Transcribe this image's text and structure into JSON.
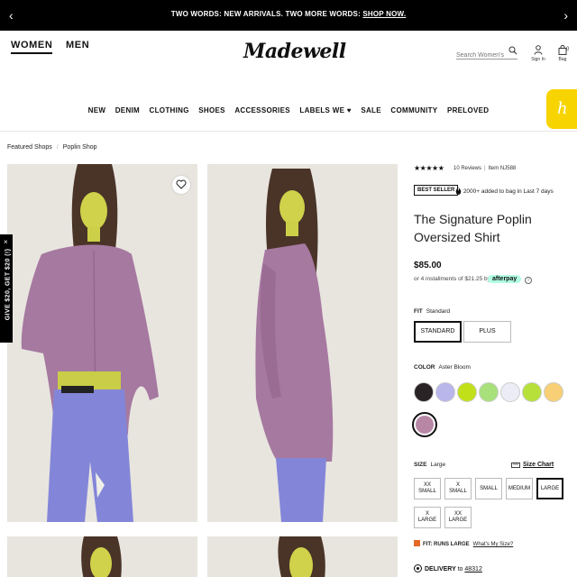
{
  "promo": {
    "message": "TWO WORDS: NEW ARRIVALS. TWO MORE WORDS: ",
    "link": "SHOP NOW.",
    "prev_icon": "chevron-left-icon",
    "next_icon": "chevron-right-icon"
  },
  "header": {
    "women": "WOMEN",
    "men": "MEN",
    "logo": "Madewell",
    "search_placeholder": "Search Women's",
    "signin": "Sign In",
    "bag": "Bag",
    "bag_count": "0"
  },
  "nav": [
    "NEW",
    "DENIM",
    "CLOTHING",
    "SHOES",
    "ACCESSORIES",
    "LABELS WE ♥",
    "SALE",
    "COMMUNITY",
    "PRELOVED"
  ],
  "breadcrumbs": [
    "Featured Shops",
    "Poplin Shop"
  ],
  "side_promo": {
    "text": "GIVE $20, GET $20 (!)",
    "close": "×"
  },
  "product": {
    "stars": "★★★★★",
    "rating": 4.5,
    "reviews": "10 Reviews",
    "item": "Item NJ588",
    "badge": "BEST SELLER",
    "added": "2000+ added to bag in Last 7 days",
    "title": "The Signature Poplin Oversized Shirt",
    "price": "$85.00",
    "installments": "or 4 installments of $21.25 by",
    "afterpay": "afterpay",
    "fit_label": "FIT",
    "fit_value": "Standard",
    "fit_options": [
      "STANDARD",
      "PLUS"
    ],
    "color_label": "COLOR",
    "color_value": "Aster Bloom",
    "colors": [
      "#2a2326",
      "#b9b6ec",
      "#c2e01a",
      "#a8e07c",
      "#ececf6",
      "#b8e03a",
      "#f8cf74",
      "#b887a6"
    ],
    "size_label": "SIZE",
    "size_value": "Large",
    "size_chart": "Size Chart",
    "sizes": [
      [
        "XX",
        "SMALL"
      ],
      [
        "X",
        "SMALL"
      ],
      [
        "SMALL"
      ],
      [
        "MEDIUM"
      ],
      [
        "LARGE"
      ],
      [
        "X",
        "LARGE"
      ],
      [
        "XX",
        "LARGE"
      ]
    ],
    "fit_note": "FIT: RUNS LARGE",
    "whats_my_size": "What's My Size?",
    "delivery": "DELIVERY",
    "delivery_to": "to",
    "zip": "48312"
  },
  "colors": {
    "accent": "#000000",
    "honey": "#f7d400",
    "afterpay": "#b2fce4"
  }
}
